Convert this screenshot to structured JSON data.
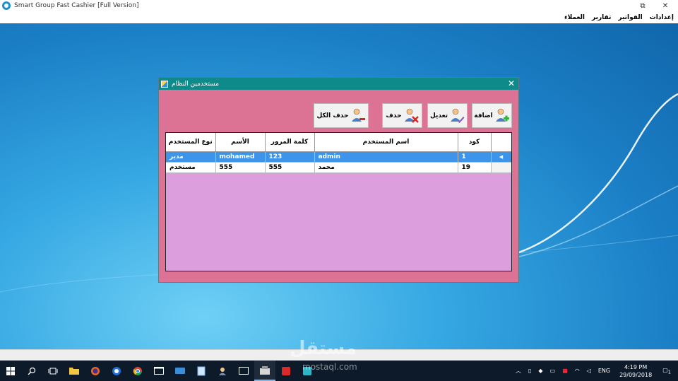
{
  "window": {
    "title": "Smart Group Fast Cashier   [Full Version]",
    "restore_glyph": "⧉",
    "close_glyph": "✕"
  },
  "menu": {
    "items": [
      "إعدادات",
      "الفواتير",
      "تقارير",
      "العملاء"
    ]
  },
  "dialog": {
    "title": "مستخدمين النظام",
    "close_glyph": "✕",
    "buttons": {
      "add": "اضافة",
      "edit": "تعديل",
      "delete": "حذف",
      "delete_all": "حذف الكل"
    },
    "grid": {
      "columns": {
        "code": "كود",
        "username": "اسم المستخدم",
        "password": "كلمة المرور",
        "name": "الأسم",
        "user_type": "نوع المستخدم"
      },
      "rows": [
        {
          "code": "1",
          "username": "admin",
          "password": "123",
          "name": "mohamed",
          "user_type": "مدير",
          "selected": true
        },
        {
          "code": "19",
          "username": "محمد",
          "password": "555",
          "name": "555",
          "user_type": "مستخدم",
          "selected": false
        }
      ]
    }
  },
  "taskbar": {
    "language": "ENG",
    "time": "4:19 PM",
    "date": "29/09/2018",
    "notification_count": "1"
  },
  "watermark": {
    "arabic": "مستقل",
    "latin": "mostaql.com"
  },
  "colors": {
    "dialog_titlebar": "#0f8a8a",
    "dialog_body": "#dc7294",
    "grid_background": "#dd9edd",
    "selected_row": "#3e94e8"
  }
}
